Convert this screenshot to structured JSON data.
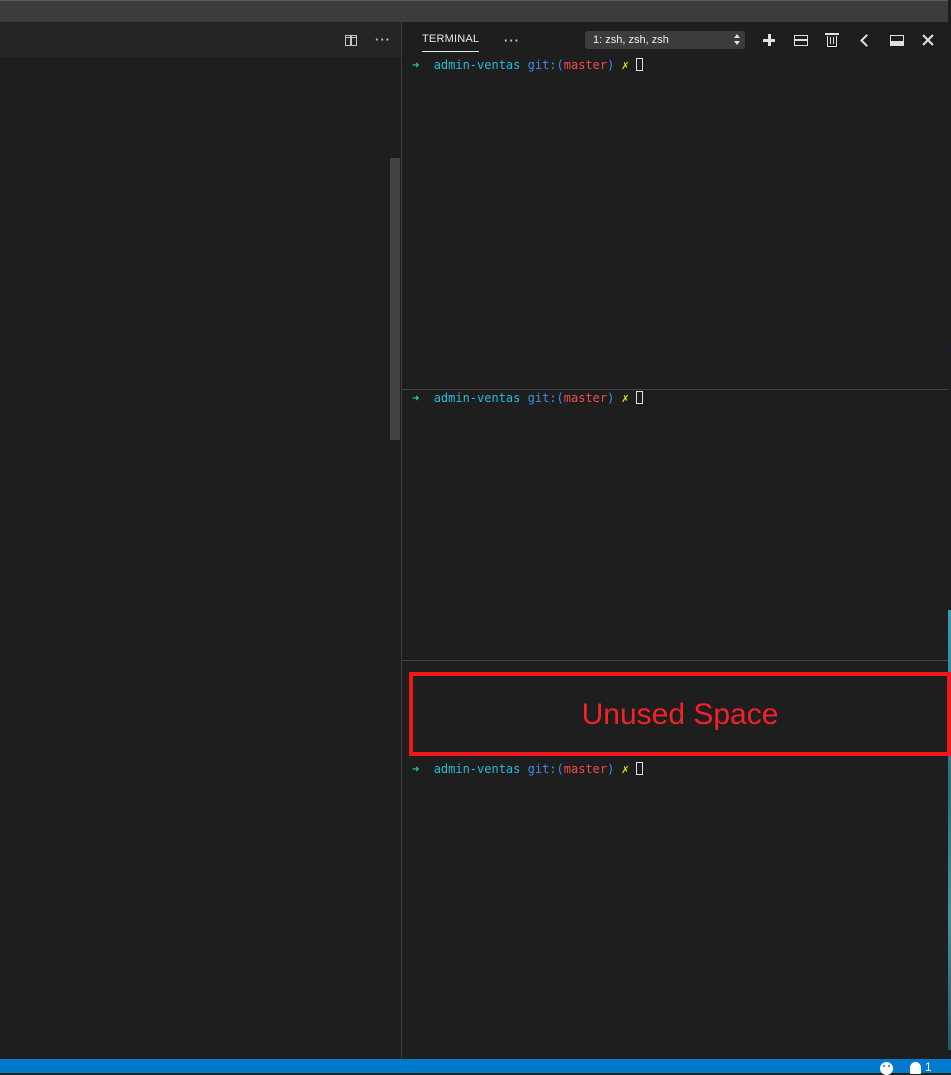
{
  "editor": {
    "actions": {
      "split_editor_icon": "split-editor-icon",
      "more_actions_label": "···"
    }
  },
  "panel": {
    "tabs": [
      {
        "label": "TERMINAL",
        "active": true
      }
    ],
    "more_label": "···",
    "terminal_selector": {
      "selected": "1: zsh, zsh, zsh"
    },
    "actions": [
      {
        "name": "new-terminal",
        "icon": "plus-icon"
      },
      {
        "name": "split-terminal",
        "icon": "split-pane-icon"
      },
      {
        "name": "kill-terminal",
        "icon": "trash-icon"
      },
      {
        "name": "toggle-maximize",
        "icon": "chevron-left-icon"
      },
      {
        "name": "panel-position",
        "icon": "panel-bottom-icon"
      },
      {
        "name": "close-panel",
        "icon": "close-icon"
      }
    ]
  },
  "terminals": [
    {
      "arrow": "➜",
      "dir": "admin-ventas",
      "git_prefix": "git:(",
      "branch": "master",
      "git_suffix": ")",
      "dirty": "✗"
    },
    {
      "arrow": "➜",
      "dir": "admin-ventas",
      "git_prefix": "git:(",
      "branch": "master",
      "git_suffix": ")",
      "dirty": "✗"
    },
    {
      "arrow": "➜",
      "dir": "admin-ventas",
      "git_prefix": "git:(",
      "branch": "master",
      "git_suffix": ")",
      "dirty": "✗"
    }
  ],
  "annotation": {
    "text": "Unused Space",
    "color": "#f0171c"
  },
  "statusbar": {
    "feedback_icon": "smiley-icon",
    "notifications_icon": "bell-icon",
    "notifications_count": "1",
    "color": "#007acc"
  },
  "theme": {
    "prompt_arrow": "#23d18b",
    "prompt_dir": "#29b8db",
    "prompt_git": "#3b8eea",
    "prompt_branch": "#f14c4c",
    "prompt_dirty": "#e5e510"
  }
}
